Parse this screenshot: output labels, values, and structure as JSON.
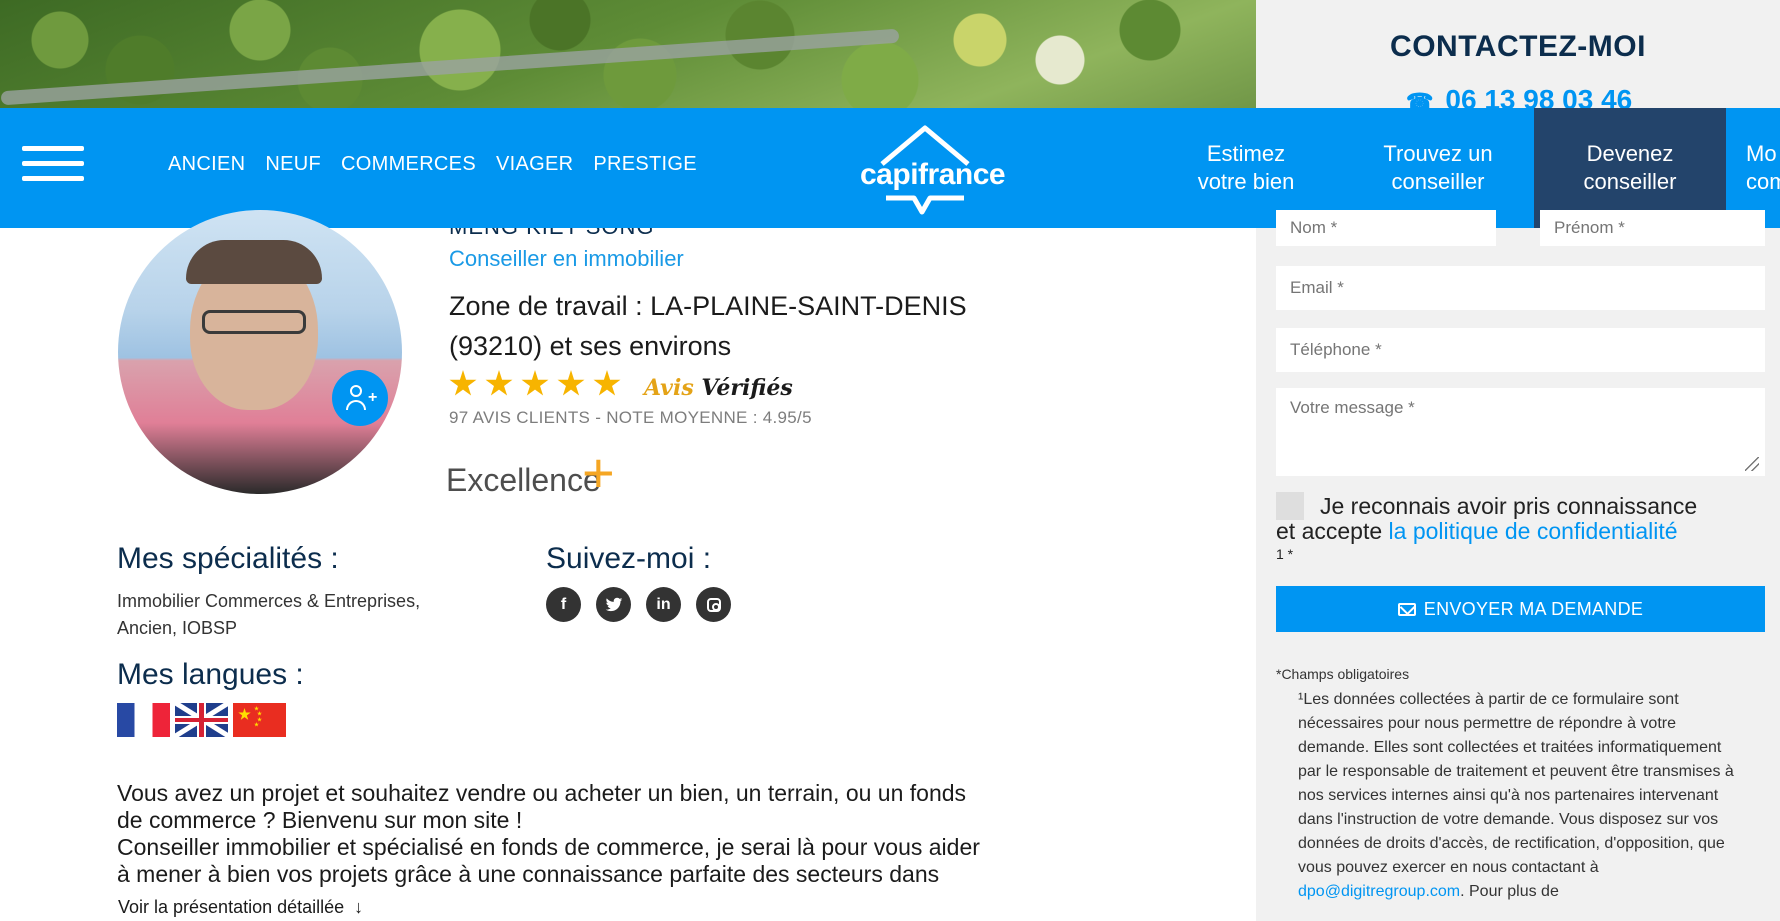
{
  "nav": {
    "links": [
      "ANCIEN",
      "NEUF",
      "COMMERCES",
      "VIAGER",
      "PRESTIGE"
    ],
    "logo": "capifrance",
    "right_items": [
      {
        "line1": "Estimez",
        "line2": "votre bien"
      },
      {
        "line1": "Trouvez un",
        "line2": "conseiller"
      },
      {
        "line1": "Devenez",
        "line2": "conseiller"
      },
      {
        "line1": "Mo",
        "line2": "com"
      }
    ]
  },
  "contact": {
    "title": "CONTACTEZ-MOI",
    "phone": "06 13 98 03 46",
    "placeholders": {
      "nom": "Nom *",
      "prenom": "Prénom *",
      "email": "Email *",
      "tel": "Téléphone *",
      "message": "Votre message *"
    },
    "consent_line1": "Je reconnais avoir pris connaissance",
    "consent_line2_prefix": "et accepte ",
    "consent_link": "la politique de confidentialité",
    "consent_required": "1 *",
    "send_label": "ENVOYER MA DEMANDE",
    "mandatory_note": "*Champs obligatoires",
    "legal_text": "¹Les données collectées à partir de ce formulaire sont nécessaires pour nous permettre de répondre à votre demande. Elles sont collectées et traitées informatiquement par le responsable de traitement et peuvent être transmises à nos services internes ainsi qu'à nos partenaires intervenant dans l'instruction de votre demande. Vous disposez sur vos données de droits d'accès, de rectification, d'opposition, que vous pouvez exercer en nous contactant à ",
    "legal_link": "dpo@digitregroup.com",
    "legal_suffix": ". Pour plus de"
  },
  "profile": {
    "name": "MENG KIET SONG",
    "role": "Conseiller en immobilier",
    "zone_label": "Zone de travail :",
    "zone_value": " LA-PLAINE-SAINT-DENIS (93210) et ses environs",
    "rating_stars": 5,
    "verified_part1": "Avis ",
    "verified_part2": "Vérifiés",
    "reviews": "97 AVIS CLIENTS - NOTE MOYENNE : 4.95/5",
    "excellence": "Excellence",
    "excellence_plus": "+"
  },
  "specialties": {
    "title": "Mes spécialités :",
    "text": "Immobilier Commerces & Entreprises, Ancien, IOBSP"
  },
  "follow": {
    "title": "Suivez-moi :",
    "networks": [
      "facebook",
      "twitter",
      "linkedin",
      "instagram"
    ]
  },
  "languages": {
    "title": "Mes langues :",
    "flags": [
      "france-flag",
      "uk-flag",
      "china-flag"
    ]
  },
  "intro": {
    "text": "Vous avez un projet et souhaitez vendre ou acheter un bien, un terrain, ou un fonds\nde commerce ?  Bienvenu sur mon site !\nConseiller immobilier et spécialisé en fonds de commerce, je serai là pour vous aider\nà mener à bien vos projets grâce à une connaissance parfaite des secteurs dans",
    "more": "Voir la présentation détaillée",
    "more_arrow": "↓"
  }
}
